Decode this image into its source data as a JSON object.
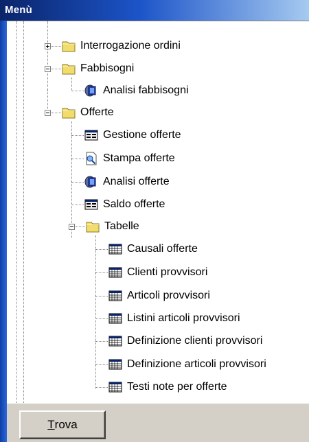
{
  "window": {
    "title": "Menù"
  },
  "tree": {
    "interrogazione": "Interrogazione ordini",
    "fabbisogni": "Fabbisogni",
    "analisi_fabbisogni": "Analisi fabbisogni",
    "offerte": "Offerte",
    "gestione_offerte": "Gestione offerte",
    "stampa_offerte": "Stampa offerte",
    "analisi_offerte": "Analisi offerte",
    "saldo_offerte": "Saldo offerte",
    "tabelle": "Tabelle",
    "causali_offerte": "Causali offerte",
    "clienti_provvisori": "Clienti provvisori",
    "articoli_provvisori": "Articoli provvisori",
    "listini_articoli": "Listini articoli provvisori",
    "def_clienti": "Definizione clienti provvisori",
    "def_articoli": "Definizione articoli provvisori",
    "testi_note": "Testi note per offerte"
  },
  "buttons": {
    "trova_first": "T",
    "trova_rest": "rova"
  },
  "colors": {
    "titlebar": "#0a246a",
    "folder": "#f2dc6b",
    "tree_bg": "#ffffff"
  }
}
